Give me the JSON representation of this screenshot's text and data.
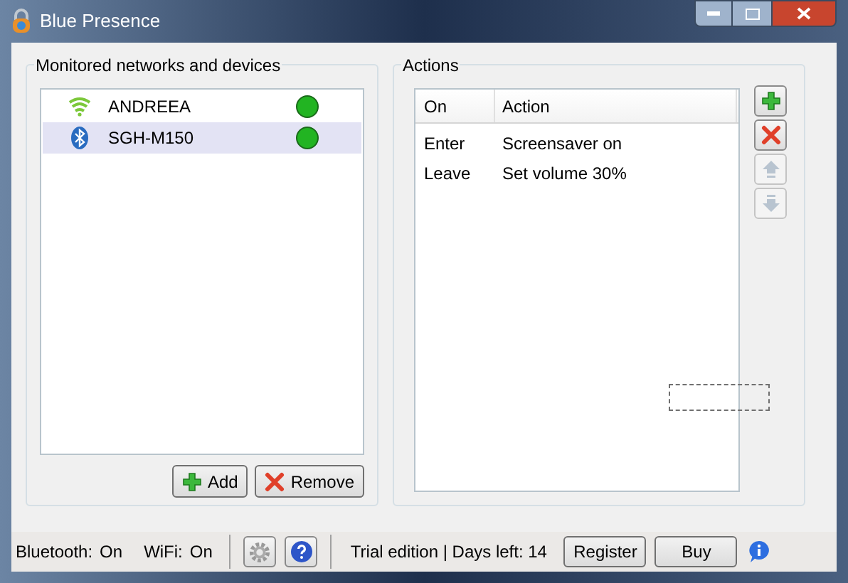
{
  "window": {
    "title": "Blue Presence"
  },
  "devices_group": {
    "title": "Monitored networks and devices",
    "items": [
      {
        "kind": "wifi",
        "name": "ANDREEA",
        "selected": false,
        "color": "#22b422"
      },
      {
        "kind": "bluetooth",
        "name": "SGH-M150",
        "selected": true,
        "color": "#22b422"
      }
    ],
    "buttons": [
      {
        "kind": "add",
        "label": "Add"
      },
      {
        "kind": "remove",
        "label": "Remove"
      }
    ]
  },
  "actions_group": {
    "title": "Actions",
    "columns": [
      "On",
      "Action"
    ],
    "rows": [
      {
        "on": "Enter",
        "action": "Screensaver on"
      },
      {
        "on": "Leave",
        "action": "Set volume 30%"
      }
    ],
    "tools": [
      {
        "kind": "add",
        "disabled": false
      },
      {
        "kind": "remove",
        "disabled": false
      },
      {
        "kind": "up",
        "disabled": true
      },
      {
        "kind": "down",
        "disabled": true
      }
    ]
  },
  "status_bar": {
    "bluetooth_label": "Bluetooth:",
    "bluetooth_value": "On",
    "wifi_label": "WiFi:",
    "wifi_value": "On",
    "trial": "Trial edition | Days left: 14",
    "buttons": [
      "Register",
      "Buy"
    ]
  }
}
